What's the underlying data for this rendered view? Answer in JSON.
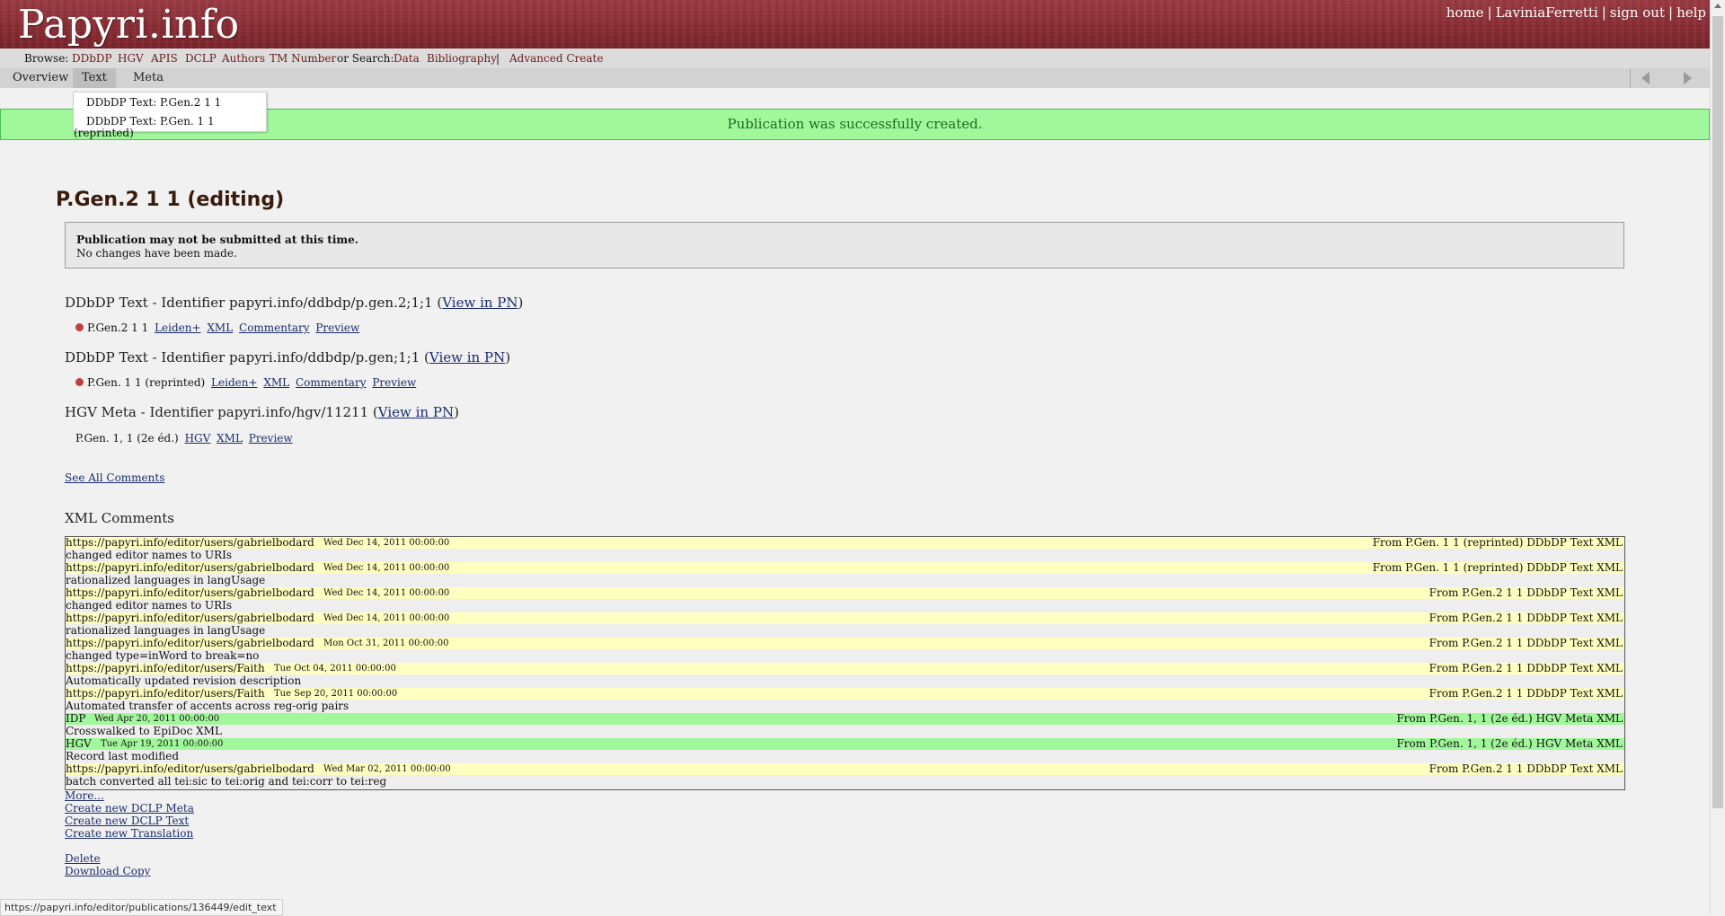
{
  "header": {
    "logo": "Papyri.info",
    "nav": {
      "home": "home",
      "user": "LaviniaFerretti",
      "sign_out": "sign out",
      "help": "help",
      "sep": "|"
    }
  },
  "browse": {
    "label": "Browse:",
    "items": [
      "DDbDP",
      "HGV",
      "APIS",
      "DCLP",
      "Authors",
      "TM Number"
    ],
    "search_label": "or Search:",
    "search_items": [
      "Data",
      "Bibliography"
    ],
    "sep": "|",
    "advanced_create": "Advanced Create"
  },
  "tabs": [
    "Overview",
    "Text",
    "Meta"
  ],
  "dropdown": {
    "items": [
      "DDbDP Text: P.Gen.2 1 1",
      "DDbDP Text: P.Gen. 1 1"
    ],
    "overflow": "(reprinted)"
  },
  "flash": "Publication was successfully created.",
  "page_title": "P.Gen.2 1 1 (editing)",
  "notice": {
    "line1": "Publication may not be submitted at this time.",
    "line2": "No changes have been made."
  },
  "identifiers": [
    {
      "heading": "DDbDP Text - Identifier papyri.info/ddbdp/p.gen.2;1;1",
      "view_link": "View in PN",
      "label": "P.Gen.2 1 1",
      "links": [
        "Leiden+",
        "XML",
        "Commentary",
        "Preview"
      ]
    },
    {
      "heading": "DDbDP Text - Identifier papyri.info/ddbdp/p.gen;1;1",
      "view_link": "View in PN",
      "label": "P.Gen. 1 1 (reprinted)",
      "links": [
        "Leiden+",
        "XML",
        "Commentary",
        "Preview"
      ]
    },
    {
      "heading": "HGV Meta - Identifier papyri.info/hgv/11211",
      "view_link": "View in PN",
      "label": "P.Gen. 1, 1 (2e éd.)",
      "links": [
        "HGV",
        "XML",
        "Preview"
      ]
    }
  ],
  "see_all_comments": "See All Comments",
  "xml_comments_heading": "XML Comments",
  "comments": [
    {
      "user": "https://papyri.info/editor/users/gabrielbodard",
      "date": "Wed Dec 14, 2011 00:00:00",
      "from": "From P.Gen. 1 1 (reprinted) DDbDP Text XML",
      "body": "changed editor names to URIs",
      "color": "yellow"
    },
    {
      "user": "https://papyri.info/editor/users/gabrielbodard",
      "date": "Wed Dec 14, 2011 00:00:00",
      "from": "From P.Gen. 1 1 (reprinted) DDbDP Text XML",
      "body": "rationalized languages in langUsage",
      "color": "yellow"
    },
    {
      "user": "https://papyri.info/editor/users/gabrielbodard",
      "date": "Wed Dec 14, 2011 00:00:00",
      "from": "From P.Gen.2 1 1 DDbDP Text XML",
      "body": "changed editor names to URIs",
      "color": "yellow"
    },
    {
      "user": "https://papyri.info/editor/users/gabrielbodard",
      "date": "Wed Dec 14, 2011 00:00:00",
      "from": "From P.Gen.2 1 1 DDbDP Text XML",
      "body": "rationalized languages in langUsage",
      "color": "yellow"
    },
    {
      "user": "https://papyri.info/editor/users/gabrielbodard",
      "date": "Mon Oct 31, 2011 00:00:00",
      "from": "From P.Gen.2 1 1 DDbDP Text XML",
      "body": "changed type=inWord to break=no",
      "color": "yellow"
    },
    {
      "user": "https://papyri.info/editor/users/Faith",
      "date": "Tue Oct 04, 2011 00:00:00",
      "from": "From P.Gen.2 1 1 DDbDP Text XML",
      "body": "Automatically updated revision description",
      "color": "yellow"
    },
    {
      "user": "https://papyri.info/editor/users/Faith",
      "date": "Tue Sep 20, 2011 00:00:00",
      "from": "From P.Gen.2 1 1 DDbDP Text XML",
      "body": "Automated transfer of accents across reg-orig pairs",
      "color": "yellow"
    },
    {
      "user": "IDP",
      "date": "Wed Apr 20, 2011 00:00:00",
      "from": "From P.Gen. 1, 1 (2e éd.) HGV Meta XML",
      "body": "Crosswalked to EpiDoc XML",
      "color": "green"
    },
    {
      "user": "HGV",
      "date": "Tue Apr 19, 2011 00:00:00",
      "from": "From P.Gen. 1, 1 (2e éd.) HGV Meta XML",
      "body": "Record last modified",
      "color": "green"
    },
    {
      "user": "https://papyri.info/editor/users/gabrielbodard",
      "date": "Wed Mar 02, 2011 00:00:00",
      "from": "From P.Gen.2 1 1 DDbDP Text XML",
      "body": "batch converted all tei:sic to tei:orig and tei:corr to tei:reg",
      "color": "yellow"
    }
  ],
  "links": {
    "more": "More...",
    "create_dclp_meta": "Create new DCLP Meta",
    "create_dclp_text": "Create new DCLP Text",
    "create_translation": "Create new Translation",
    "delete": "Delete",
    "download": "Download Copy"
  },
  "status_url": "https://papyri.info/editor/publications/136449/edit_text",
  "colors": {
    "header_red": "#8a2c34",
    "flash_green": "#a1f89b",
    "comment_yellow": "#ffffc0",
    "link_blue": "#1a2d6e"
  }
}
